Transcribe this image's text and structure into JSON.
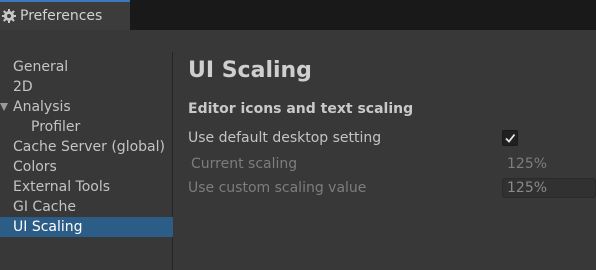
{
  "window": {
    "tab_title": "Preferences",
    "tab_icon": "gear-icon"
  },
  "sidebar": {
    "items": [
      {
        "label": "General"
      },
      {
        "label": "2D"
      },
      {
        "label": "Analysis"
      },
      {
        "label": "Profiler"
      },
      {
        "label": "Cache Server (global)"
      },
      {
        "label": "Colors"
      },
      {
        "label": "External Tools"
      },
      {
        "label": "GI Cache"
      },
      {
        "label": "UI Scaling"
      }
    ],
    "selected": "UI Scaling"
  },
  "main": {
    "title": "UI Scaling",
    "section_title": "Editor icons and text scaling",
    "use_default": {
      "label": "Use default desktop setting",
      "checked": true
    },
    "current_scaling": {
      "label": "Current scaling",
      "value": "125%"
    },
    "custom_scaling": {
      "label": "Use custom scaling value",
      "value": "125%"
    }
  },
  "colors": {
    "accent": "#2c5d87",
    "tab_accent": "#3a79bb"
  }
}
